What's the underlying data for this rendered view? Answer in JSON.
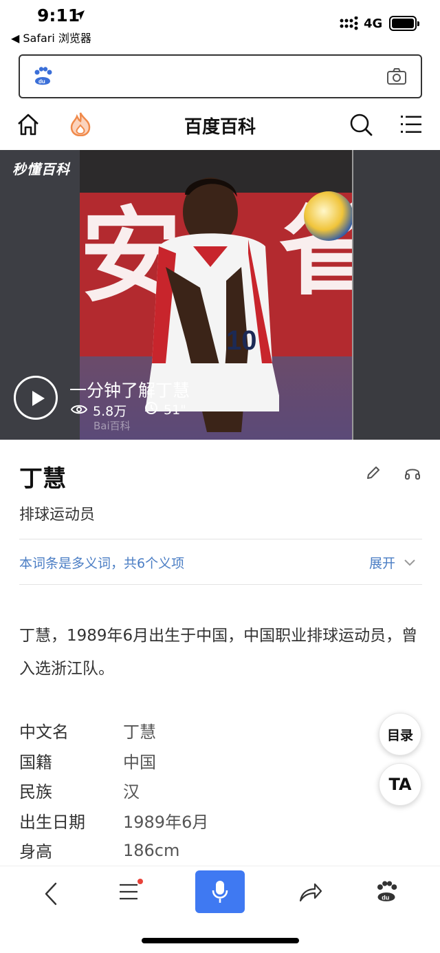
{
  "status_bar": {
    "time": "9:11",
    "back_app": "◀ Safari 浏览器",
    "network": "4G"
  },
  "search": {
    "placeholder": ""
  },
  "nav": {
    "title": "百度百科"
  },
  "video": {
    "brand_logo": "秒懂百科",
    "title": "一分钟了解丁慧",
    "views": "5.8万",
    "duration": "51\"",
    "watermark": "Bai百科"
  },
  "entry": {
    "title": "丁慧",
    "subtitle": "排球运动员",
    "polysemy_text": "本词条是多义词，共6个义项",
    "expand_label": "展开",
    "summary": "丁慧，1989年6月出生于中国，中国职业排球运动员，曾入选浙江队。"
  },
  "infobox": [
    {
      "key": "中文名",
      "value": "丁慧"
    },
    {
      "key": "国籍",
      "value": "中国"
    },
    {
      "key": "民族",
      "value": "汉"
    },
    {
      "key": "出生日期",
      "value": "1989年6月"
    },
    {
      "key": "身高",
      "value": "186cm"
    }
  ],
  "floating": {
    "toc": "目录",
    "font": "TA"
  },
  "colors": {
    "link_blue": "#4a7dc4",
    "mic_blue": "#3f79f2",
    "flame_orange": "#f08a4b",
    "notify_red": "#e8433a"
  }
}
